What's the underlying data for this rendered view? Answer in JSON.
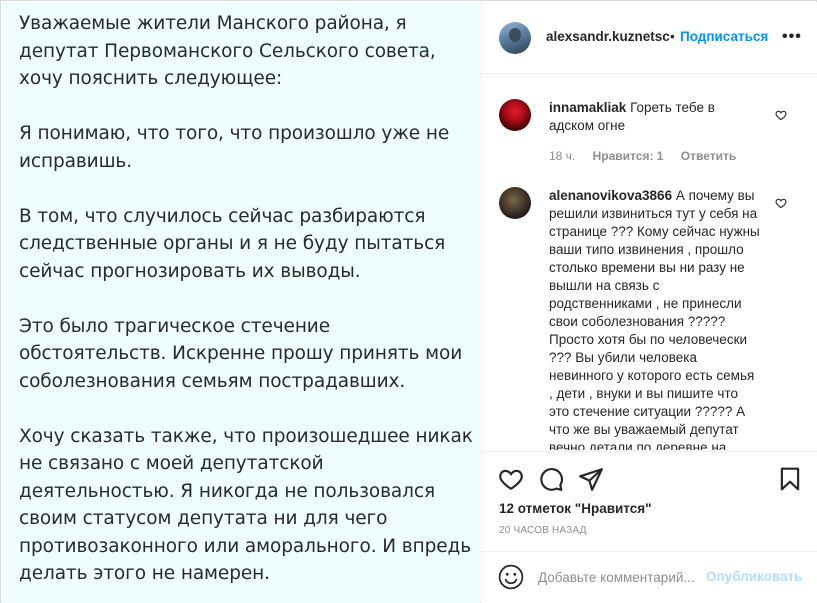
{
  "post": {
    "paragraphs": [
      "Уважаемые жители Манского района, я депутат Первоманского Сельского совета, хочу пояснить следующее:",
      "Я понимаю, что того, что произошло уже не исправишь.",
      "В том, что случилось сейчас разбираются следственные органы и я не буду пытаться сейчас прогнозировать их выводы.",
      "Это было трагическое стечение обстоятельств. Искренне прошу принять мои соболезнования семьям пострадавших.",
      "Хочу сказать также, что произошедшее никак не связано с моей депутатской деятельностью. Я никогда не пользовался своим статусом депутата ни для чего противозаконного или аморального. И впредь делать этого не намерен."
    ]
  },
  "header": {
    "username": "alexsandr.kuznetsc",
    "separator": "•",
    "follow_label": "Подписаться",
    "more_label": "•••"
  },
  "comments": [
    {
      "username": "innamakliak",
      "text": "Гореть тебе в адском огне",
      "time": "18 ч.",
      "likes": "Нравится: 1",
      "reply": "Ответить"
    },
    {
      "username": "alenanovikova3866",
      "text": "А почему вы решили извиниться тут у себя на странице ??? Кому сейчас нужны ваши типо извинения , прошло столько времени вы ни разу не вышли на связь с родственниками , не принесли свои соболезнования ????? Просто хотя бы по человечески ??? Вы убили человека невинного у которого есть семья , дети , внуки и вы пишите что это стечение ситуации ????? А что же вы уважаемый депутат вечно детали по деревне на"
    }
  ],
  "actions": {
    "likes_text": "12 отметок \"Нравится\"",
    "time_ago": "20 ЧАСОВ НАЗАД"
  },
  "composer": {
    "placeholder": "Добавьте комментарий...",
    "publish_label": "Опубликовать"
  },
  "colors": {
    "accent": "#0095f6",
    "publish_disabled": "#b2dffc",
    "post_background": "#eefdfd"
  }
}
